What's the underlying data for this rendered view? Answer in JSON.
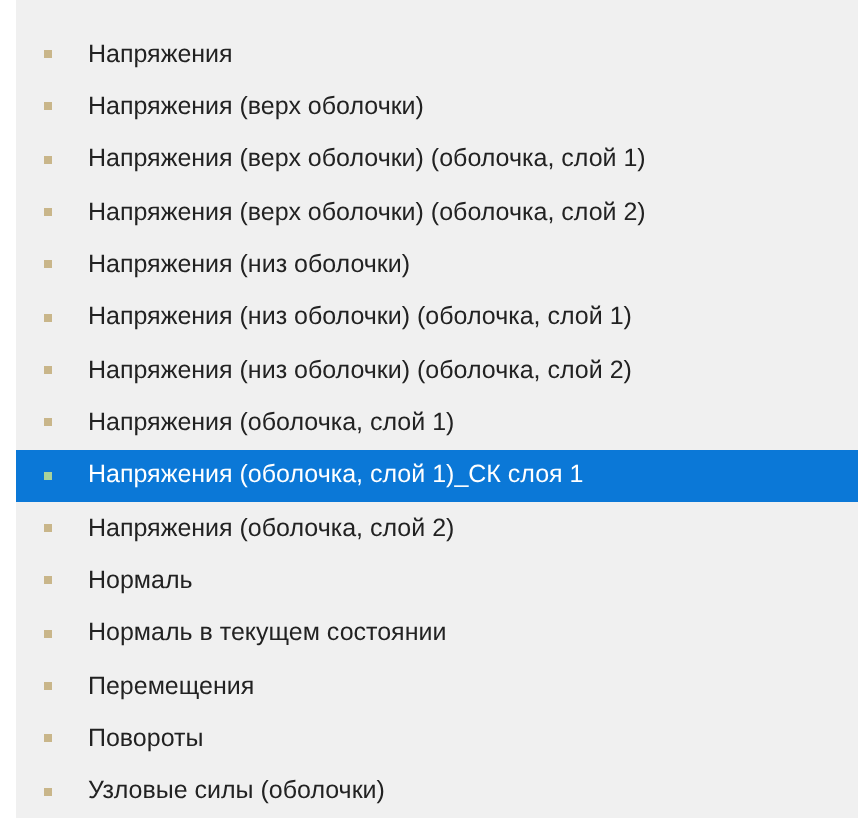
{
  "list": {
    "items": [
      {
        "label": "Напряжения",
        "selected": false
      },
      {
        "label": "Напряжения (верх оболочки)",
        "selected": false
      },
      {
        "label": "Напряжения (верх оболочки) (оболочка, слой 1)",
        "selected": false
      },
      {
        "label": "Напряжения (верх оболочки) (оболочка, слой 2)",
        "selected": false
      },
      {
        "label": "Напряжения (низ оболочки)",
        "selected": false
      },
      {
        "label": "Напряжения (низ оболочки) (оболочка, слой 1)",
        "selected": false
      },
      {
        "label": "Напряжения (низ оболочки) (оболочка, слой 2)",
        "selected": false
      },
      {
        "label": "Напряжения (оболочка, слой 1)",
        "selected": false
      },
      {
        "label": "Напряжения (оболочка, слой 1)_СК слоя 1",
        "selected": true
      },
      {
        "label": "Напряжения (оболочка, слой 2)",
        "selected": false
      },
      {
        "label": "Нормаль",
        "selected": false
      },
      {
        "label": "Нормаль в текущем состоянии",
        "selected": false
      },
      {
        "label": "Перемещения",
        "selected": false
      },
      {
        "label": "Повороты",
        "selected": false
      },
      {
        "label": "Узловые силы (оболочки)",
        "selected": false
      }
    ]
  }
}
